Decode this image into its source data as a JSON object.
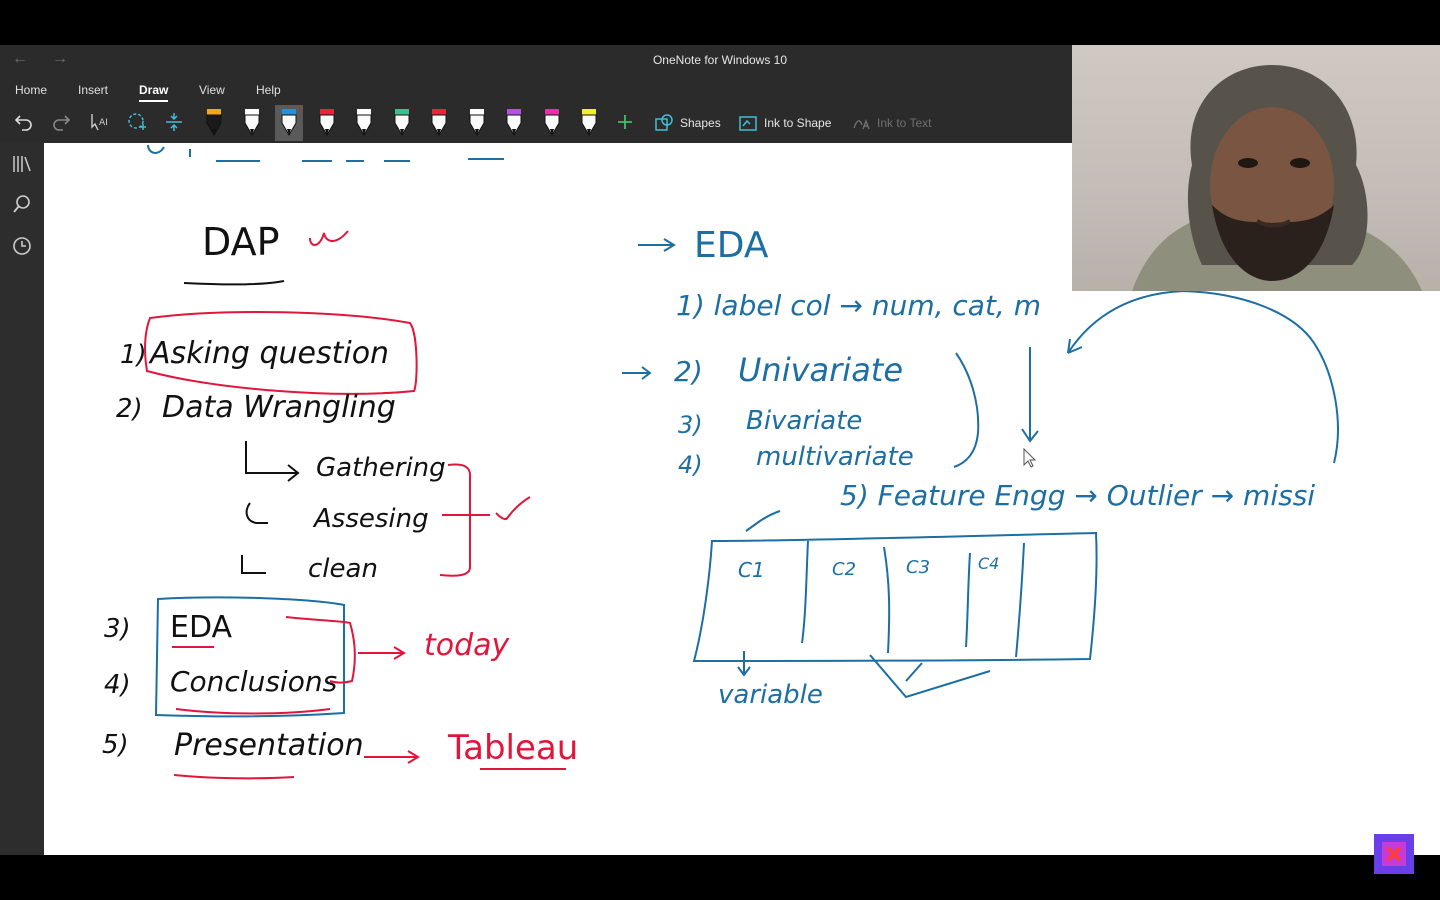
{
  "window": {
    "title": "OneNote for Windows 10",
    "back": "←",
    "forward": "→"
  },
  "menu": {
    "tabs": [
      {
        "label": "Home"
      },
      {
        "label": "Insert"
      },
      {
        "label": "Draw",
        "active": true
      },
      {
        "label": "View"
      },
      {
        "label": "Help"
      }
    ]
  },
  "toolbar": {
    "undo_icon": "undo-icon",
    "redo_icon": "redo-icon",
    "pen_colors": [
      "#f7a41d",
      "#ffffff",
      "#2a8fd8",
      "#e8233a",
      "#ffffff",
      "#3fbf8b",
      "#e8233a",
      "#ffffff",
      "#b252e0",
      "#ec2fa7",
      "#f3ee27"
    ],
    "shapes_label": "Shapes",
    "ink_to_shape_label": "Ink to Shape",
    "ink_to_text_label": "Ink to Text"
  },
  "sidebar": {
    "icons": [
      "notebooks-icon",
      "search-icon",
      "recent-icon"
    ]
  },
  "colors": {
    "ink_blue": "#1d6ea3",
    "ink_black": "#111111",
    "ink_red": "#e0163c",
    "chrome": "#2b2b2b"
  },
  "notes": {
    "left": {
      "title": "DAP",
      "steps": [
        "1)",
        "Asking question",
        "2)",
        "Data Wrangling",
        "Gathering",
        "Assesing",
        "clean",
        "3)",
        "EDA",
        "4)",
        "Conclusions",
        "5)",
        "Presentation"
      ],
      "today": "today",
      "tableau": "Tableau"
    },
    "right": {
      "heading": "EDA",
      "item1": "1) label col → num, cat, m",
      "item2_num": "2)",
      "item2": "Univariate",
      "item3_num": "3)",
      "item3": "Bivariate",
      "item4_num": "4)",
      "item4": "multivariate",
      "item5": "5) Feature Engg → Outlier → missi",
      "cols": [
        "C1",
        "C2",
        "C3",
        "C4"
      ],
      "variable": "variable"
    }
  }
}
